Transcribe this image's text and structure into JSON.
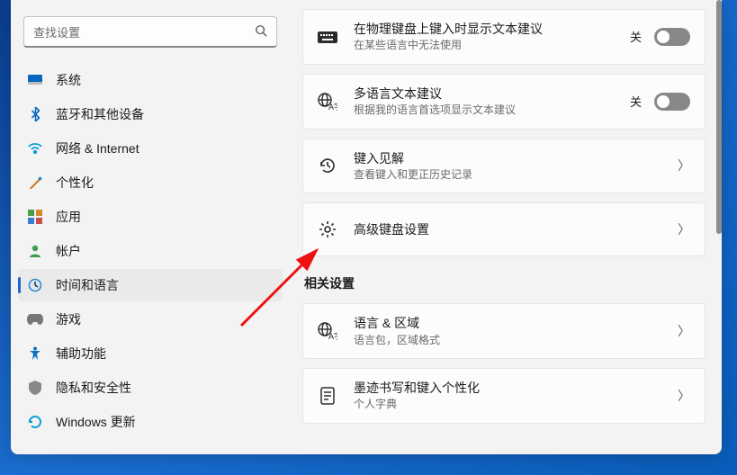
{
  "search": {
    "placeholder": "查找设置"
  },
  "sidebar": {
    "items": [
      {
        "label": "系统",
        "active": false,
        "icon": "system-icon"
      },
      {
        "label": "蓝牙和其他设备",
        "active": false,
        "icon": "bluetooth-icon"
      },
      {
        "label": "网络 & Internet",
        "active": false,
        "icon": "network-icon"
      },
      {
        "label": "个性化",
        "active": false,
        "icon": "personalization-icon"
      },
      {
        "label": "应用",
        "active": false,
        "icon": "apps-icon"
      },
      {
        "label": "帐户",
        "active": false,
        "icon": "accounts-icon"
      },
      {
        "label": "时间和语言",
        "active": true,
        "icon": "time-language-icon"
      },
      {
        "label": "游戏",
        "active": false,
        "icon": "gaming-icon"
      },
      {
        "label": "辅助功能",
        "active": false,
        "icon": "accessibility-icon"
      },
      {
        "label": "隐私和安全性",
        "active": false,
        "icon": "privacy-icon"
      },
      {
        "label": "Windows 更新",
        "active": false,
        "icon": "update-icon"
      }
    ]
  },
  "main": {
    "items": [
      {
        "icon": "keyboard-icon",
        "title": "在物理键盘上键入时显示文本建议",
        "sub": "在某些语言中无法使用",
        "tail": "toggle",
        "state": "关"
      },
      {
        "icon": "multilingual-icon",
        "title": "多语言文本建议",
        "sub": "根据我的语言首选项显示文本建议",
        "tail": "toggle",
        "state": "关"
      },
      {
        "icon": "insights-icon",
        "title": "键入见解",
        "sub": "查看键入和更正历史记录",
        "tail": "chevron"
      },
      {
        "icon": "gear-icon",
        "title": "高级键盘设置",
        "sub": "",
        "tail": "chevron"
      }
    ],
    "related_header": "相关设置",
    "related": [
      {
        "icon": "language-region-icon",
        "title": "语言 & 区域",
        "sub": "语言包，区域格式",
        "tail": "chevron"
      },
      {
        "icon": "inking-icon",
        "title": "墨迹书写和键入个性化",
        "sub": "个人字典",
        "tail": "chevron"
      }
    ]
  }
}
